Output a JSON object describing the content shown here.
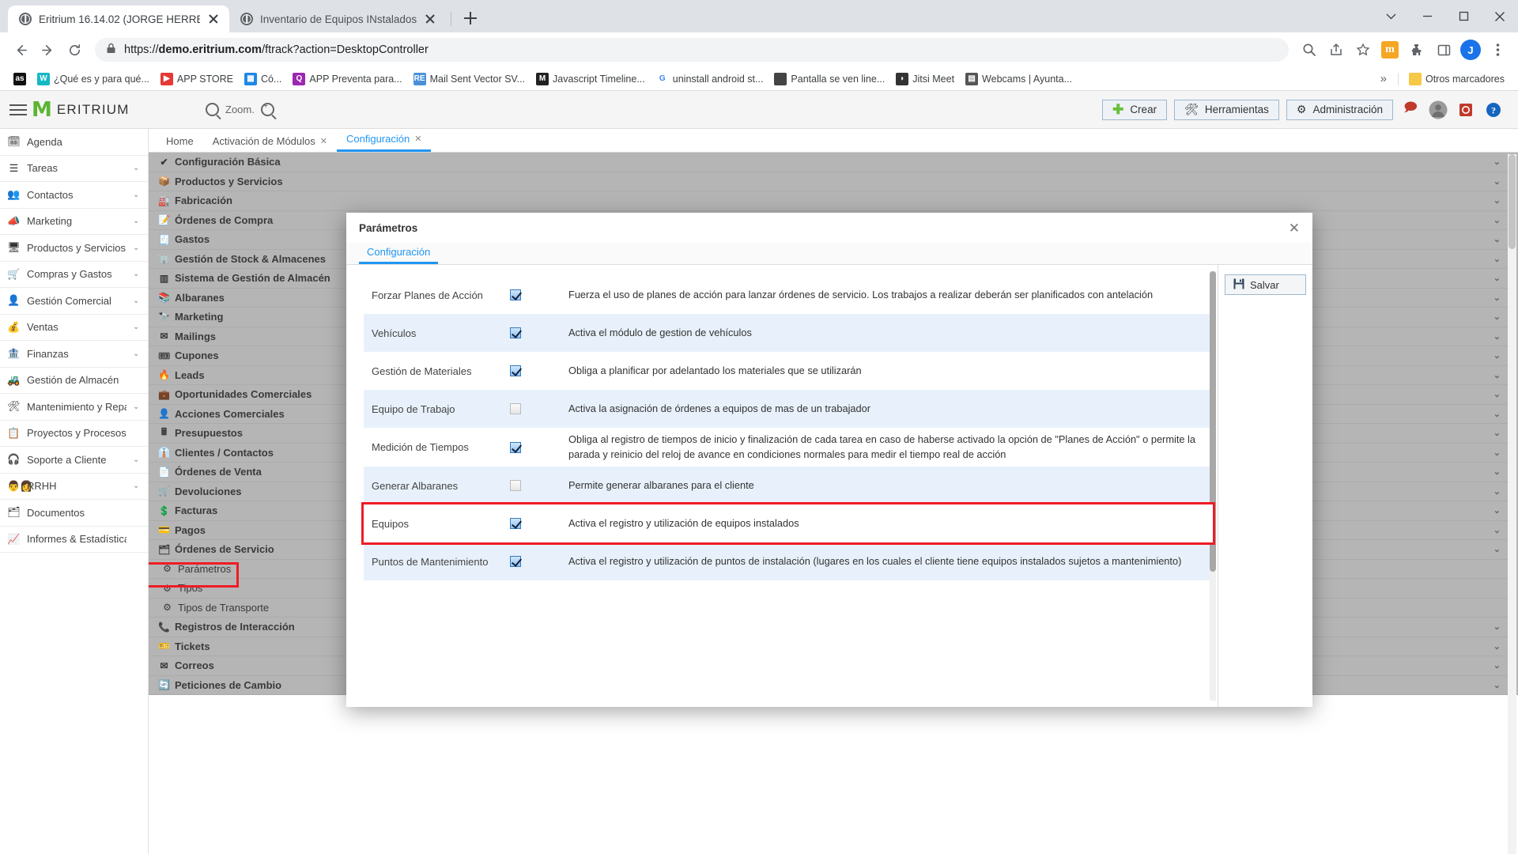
{
  "browser": {
    "tabs": [
      {
        "title": "Eritrium 16.14.02 (JORGE HERRER",
        "active": true
      },
      {
        "title": "Inventario de Equipos INstalados",
        "active": false
      }
    ],
    "new_tab_label": "+",
    "url": "https://demo.eritrium.com/ftrack?action=DesktopController",
    "url_bold": "demo.eritrium.com",
    "url_prefix": "https://",
    "url_suffix": "/ftrack?action=DesktopController",
    "profile_initial": "J",
    "extension_badge": "m",
    "bookmarks": [
      {
        "label": "",
        "icon": "as",
        "color": "#111111"
      },
      {
        "label": "¿Qué es y para qué...",
        "icon": "W",
        "color": "#14b8c4"
      },
      {
        "label": "APP STORE",
        "icon": "▶",
        "color": "#e53935"
      },
      {
        "label": "Có...",
        "icon": "▦",
        "color": "#1e88e5"
      },
      {
        "label": "APP Preventa para...",
        "icon": "Q",
        "color": "#9c27b0"
      },
      {
        "label": "Mail Sent Vector SV...",
        "icon": "RE",
        "color": "#4a90d9"
      },
      {
        "label": "Javascript Timeline...",
        "icon": "M",
        "color": "#222222"
      },
      {
        "label": "uninstall android st...",
        "icon": "G",
        "color": "#ffffff"
      },
      {
        "label": "Pantalla se ven line...",
        "icon": "",
        "color": "#444444"
      },
      {
        "label": "Jitsi Meet",
        "icon": "◗",
        "color": "#333333"
      },
      {
        "label": "Webcams | Ayunta...",
        "icon": "▤",
        "color": "#555555"
      }
    ],
    "overflow_label": "»",
    "other_bookmarks_label": "Otros marcadores"
  },
  "app": {
    "brand": "ERITRIUM",
    "zoom_label": "Zoom.",
    "header_buttons": [
      {
        "label": "Crear",
        "icon": "plus-icon"
      },
      {
        "label": "Herramientas",
        "icon": "tools-icon"
      },
      {
        "label": "Administración",
        "icon": "gear-icon"
      }
    ],
    "sidebar": [
      {
        "label": "Agenda",
        "icon": "calendar-icon",
        "chevron": false
      },
      {
        "label": "Tareas",
        "icon": "tasks-icon",
        "chevron": true
      },
      {
        "label": "Contactos",
        "icon": "contacts-icon",
        "chevron": true
      },
      {
        "label": "Marketing",
        "icon": "megaphone-icon",
        "chevron": true
      },
      {
        "label": "Productos y Servicios",
        "icon": "box-icon",
        "chevron": true
      },
      {
        "label": "Compras y Gastos",
        "icon": "cart-icon",
        "chevron": true
      },
      {
        "label": "Gestión Comercial",
        "icon": "person-icon",
        "chevron": true
      },
      {
        "label": "Ventas",
        "icon": "money-icon",
        "chevron": true
      },
      {
        "label": "Finanzas",
        "icon": "bank-icon",
        "chevron": true
      },
      {
        "label": "Gestión de Almacén",
        "icon": "forklift-icon",
        "chevron": false
      },
      {
        "label": "Mantenimiento y Reparación",
        "icon": "tools-icon",
        "chevron": true
      },
      {
        "label": "Proyectos y Procesos",
        "icon": "project-icon",
        "chevron": false
      },
      {
        "label": "Soporte a Cliente",
        "icon": "headset-icon",
        "chevron": true
      },
      {
        "label": "RRHH",
        "icon": "people-icon",
        "chevron": true
      },
      {
        "label": "Documentos",
        "icon": "folder-icon",
        "chevron": false
      },
      {
        "label": "Informes & Estadísticas",
        "icon": "chart-icon",
        "chevron": false
      }
    ],
    "main_tabs": [
      {
        "label": "Home",
        "closable": false,
        "active": false
      },
      {
        "label": "Activación de Módulos",
        "closable": true,
        "active": false
      },
      {
        "label": "Configuración",
        "closable": true,
        "active": true
      }
    ],
    "config_items": [
      {
        "label": "Configuración Básica",
        "icon": "✔",
        "sub": false,
        "chevron": true
      },
      {
        "label": "Productos y Servicios",
        "icon": "📦",
        "sub": false,
        "chevron": true
      },
      {
        "label": "Fabricación",
        "icon": "🏭",
        "sub": false,
        "chevron": true
      },
      {
        "label": "Órdenes de Compra",
        "icon": "📝",
        "sub": false,
        "chevron": true
      },
      {
        "label": "Gastos",
        "icon": "🧾",
        "sub": false,
        "chevron": true
      },
      {
        "label": "Gestión de Stock & Almacenes",
        "icon": "🏢",
        "sub": false,
        "chevron": true
      },
      {
        "label": "Sistema de Gestión de Almacén",
        "icon": "▥",
        "sub": false,
        "chevron": true
      },
      {
        "label": "Albaranes",
        "icon": "📚",
        "sub": false,
        "chevron": true
      },
      {
        "label": "Marketing",
        "icon": "🔭",
        "sub": false,
        "chevron": true
      },
      {
        "label": "Mailings",
        "icon": "✉",
        "sub": false,
        "chevron": true
      },
      {
        "label": "Cupones",
        "icon": "🎟",
        "sub": false,
        "chevron": true
      },
      {
        "label": "Leads",
        "icon": "🔥",
        "sub": false,
        "chevron": true
      },
      {
        "label": "Oportunidades Comerciales",
        "icon": "💼",
        "sub": false,
        "chevron": true
      },
      {
        "label": "Acciones Comerciales",
        "icon": "👤",
        "sub": false,
        "chevron": true
      },
      {
        "label": "Presupuestos",
        "icon": "🖩",
        "sub": false,
        "chevron": true
      },
      {
        "label": "Clientes / Contactos",
        "icon": "👔",
        "sub": false,
        "chevron": true
      },
      {
        "label": "Órdenes de Venta",
        "icon": "📄",
        "sub": false,
        "chevron": true
      },
      {
        "label": "Devoluciones",
        "icon": "🛒",
        "sub": false,
        "chevron": true
      },
      {
        "label": "Facturas",
        "icon": "💲",
        "sub": false,
        "chevron": true
      },
      {
        "label": "Pagos",
        "icon": "💳",
        "sub": false,
        "chevron": true
      },
      {
        "label": "Órdenes de Servicio",
        "icon": "🗂",
        "sub": false,
        "chevron": true
      },
      {
        "label": "Parámetros",
        "icon": "⚙",
        "sub": true,
        "chevron": false
      },
      {
        "label": "Tipos",
        "icon": "⚙",
        "sub": true,
        "chevron": false
      },
      {
        "label": "Tipos de Transporte",
        "icon": "⚙",
        "sub": true,
        "chevron": false
      },
      {
        "label": "Registros de Interacción",
        "icon": "📞",
        "sub": false,
        "chevron": true
      },
      {
        "label": "Tickets",
        "icon": "🎫",
        "sub": false,
        "chevron": true
      },
      {
        "label": "Correos",
        "icon": "✉",
        "sub": false,
        "chevron": true
      },
      {
        "label": "Peticiones de Cambio",
        "icon": "🔄",
        "sub": false,
        "chevron": true
      }
    ]
  },
  "modal": {
    "title": "Parámetros",
    "close_label": "✕",
    "tab_label": "Configuración",
    "save_label": "Salvar",
    "save_icon": "save-icon",
    "rows": [
      {
        "label": "Forzar Planes de Acción",
        "checked": true,
        "desc": "Fuerza el uso de planes de acción para lanzar órdenes de servicio. Los trabajos a realizar deberán ser planificados con antelación"
      },
      {
        "label": "Vehículos",
        "checked": true,
        "desc": "Activa el módulo de gestion de vehículos"
      },
      {
        "label": "Gestión de Materiales",
        "checked": true,
        "desc": "Obliga a planificar por adelantado los materiales que se utilizarán"
      },
      {
        "label": "Equipo de Trabajo",
        "checked": false,
        "desc": "Activa la asignación de órdenes a equipos de mas de un trabajador"
      },
      {
        "label": "Medición de Tiempos",
        "checked": true,
        "desc": "Obliga al registro de tiempos de inicio y finalización de cada tarea en caso de haberse activado la opción de \"Planes de Acción\" o permite la parada y reinicio del reloj de avance en condiciones normales para medir el tiempo real de acción"
      },
      {
        "label": "Generar Albaranes",
        "checked": false,
        "desc": "Permite generar albaranes para el cliente"
      },
      {
        "label": "Equipos",
        "checked": true,
        "desc": "Activa el registro y utilización de equipos instalados",
        "highlighted": true
      },
      {
        "label": "Puntos de Mantenimiento",
        "checked": true,
        "desc": "Activa el registro y utilización de puntos de instalación (lugares en los cuales el cliente tiene equipos instalados sujetos a mantenimiento)"
      }
    ]
  },
  "highlights": {
    "parametros_menu": "Parámetros",
    "equipos_row": "Equipos"
  }
}
